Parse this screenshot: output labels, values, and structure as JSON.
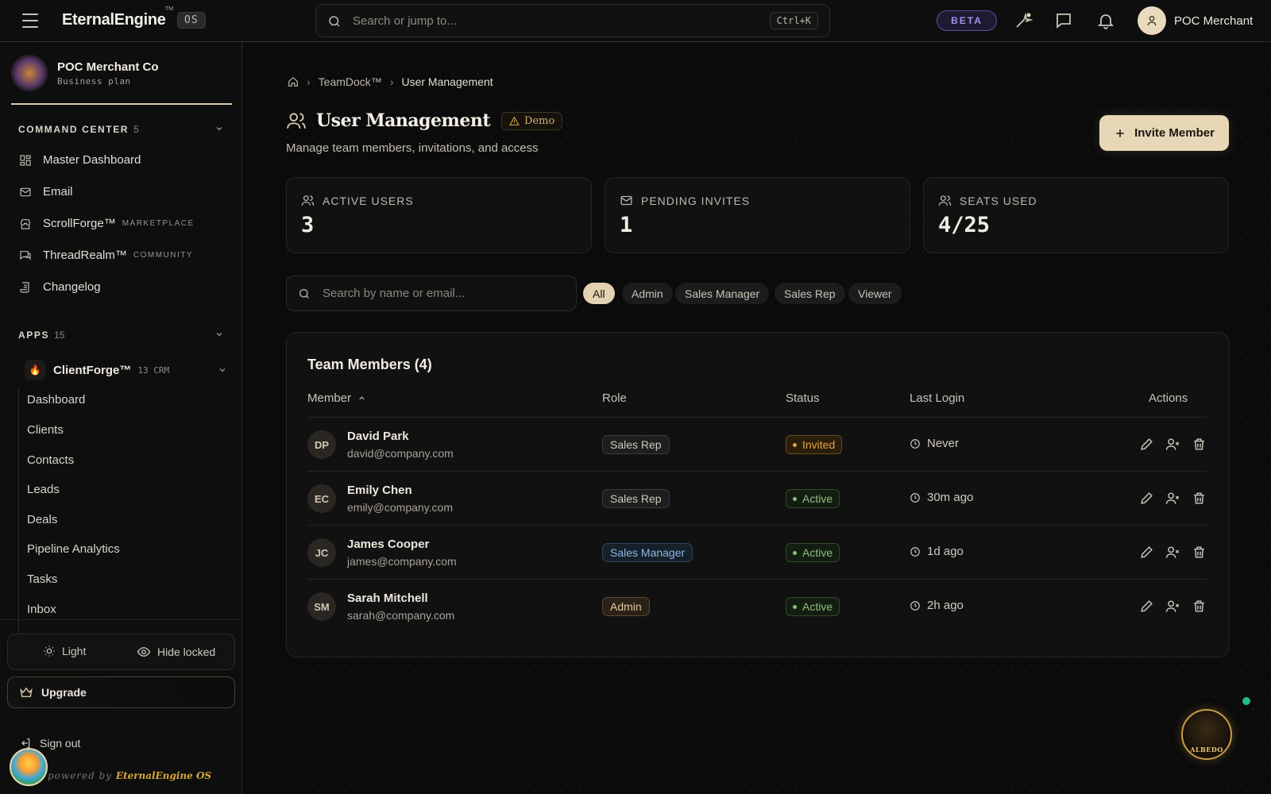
{
  "topbar": {
    "brand": "EternalEngine",
    "brand_tm": "TM",
    "os_badge": "OS",
    "search_placeholder": "Search or jump to...",
    "search_shortcut": "Ctrl+K",
    "beta_label": "BETA",
    "user_name": "POC Merchant"
  },
  "sidebar": {
    "org_name": "POC Merchant Co",
    "org_plan": "Business plan",
    "command_center": {
      "label": "COMMAND CENTER",
      "count": "5"
    },
    "nav": [
      {
        "label": "Master Dashboard",
        "tag": ""
      },
      {
        "label": "Email",
        "tag": ""
      },
      {
        "label": "ScrollForge™",
        "tag": "MARKETPLACE"
      },
      {
        "label": "ThreadRealm™",
        "tag": "COMMUNITY"
      },
      {
        "label": "Changelog",
        "tag": ""
      }
    ],
    "apps": {
      "label": "APPS",
      "count": "15"
    },
    "clientforge": {
      "name": "ClientForge™",
      "sub": "13 CRM"
    },
    "subnav": [
      "Dashboard",
      "Clients",
      "Contacts",
      "Leads",
      "Deals",
      "Pipeline Analytics",
      "Tasks",
      "Inbox"
    ],
    "theme_toggle": "Light",
    "hide_locked": "Hide locked",
    "upgrade": "Upgrade",
    "signout": "Sign out",
    "powered_prefix": "powered by",
    "powered_brand": "EternalEngine OS"
  },
  "main": {
    "breadcrumb": [
      "TeamDock™",
      "User Management"
    ],
    "title": "User Management",
    "demo_badge": "Demo",
    "subtitle": "Manage team members, invitations, and access",
    "invite_button": "Invite Member",
    "stats": [
      {
        "label": "ACTIVE USERS",
        "value": "3",
        "icon": "users-icon"
      },
      {
        "label": "PENDING INVITES",
        "value": "1",
        "icon": "mail-icon"
      },
      {
        "label": "SEATS USED",
        "value": "4/25",
        "icon": "users-icon"
      }
    ],
    "member_search_placeholder": "Search by name or email...",
    "filters": [
      {
        "label": "All",
        "active": true
      },
      {
        "label": "Admin",
        "active": false
      },
      {
        "label": "Sales Manager",
        "active": false
      },
      {
        "label": "Sales Rep",
        "active": false
      },
      {
        "label": "Viewer",
        "active": false
      }
    ],
    "table": {
      "title": "Team Members (4)",
      "headers": {
        "member": "Member",
        "role": "Role",
        "status": "Status",
        "last_login": "Last Login",
        "actions": "Actions"
      },
      "rows": [
        {
          "initials": "DP",
          "name": "David Park",
          "email": "david@company.com",
          "role": "Sales Rep",
          "role_kind": "rep",
          "status": "Invited",
          "status_kind": "invited",
          "last_login": "Never"
        },
        {
          "initials": "EC",
          "name": "Emily Chen",
          "email": "emily@company.com",
          "role": "Sales Rep",
          "role_kind": "rep",
          "status": "Active",
          "status_kind": "active",
          "last_login": "30m ago"
        },
        {
          "initials": "JC",
          "name": "James Cooper",
          "email": "james@company.com",
          "role": "Sales Manager",
          "role_kind": "manager",
          "status": "Active",
          "status_kind": "active",
          "last_login": "1d ago"
        },
        {
          "initials": "SM",
          "name": "Sarah Mitchell",
          "email": "sarah@company.com",
          "role": "Admin",
          "role_kind": "admin",
          "status": "Active",
          "status_kind": "active",
          "last_login": "2h ago"
        }
      ]
    },
    "assistant_label": "ALBEDO"
  },
  "colors": {
    "accent": "#e8d7b7",
    "beta": "#9d94e6",
    "invited": "#e0a54a",
    "active": "#8bc07a",
    "manager_role": "#8fb7e0",
    "online_dot": "#1fbf8a"
  }
}
